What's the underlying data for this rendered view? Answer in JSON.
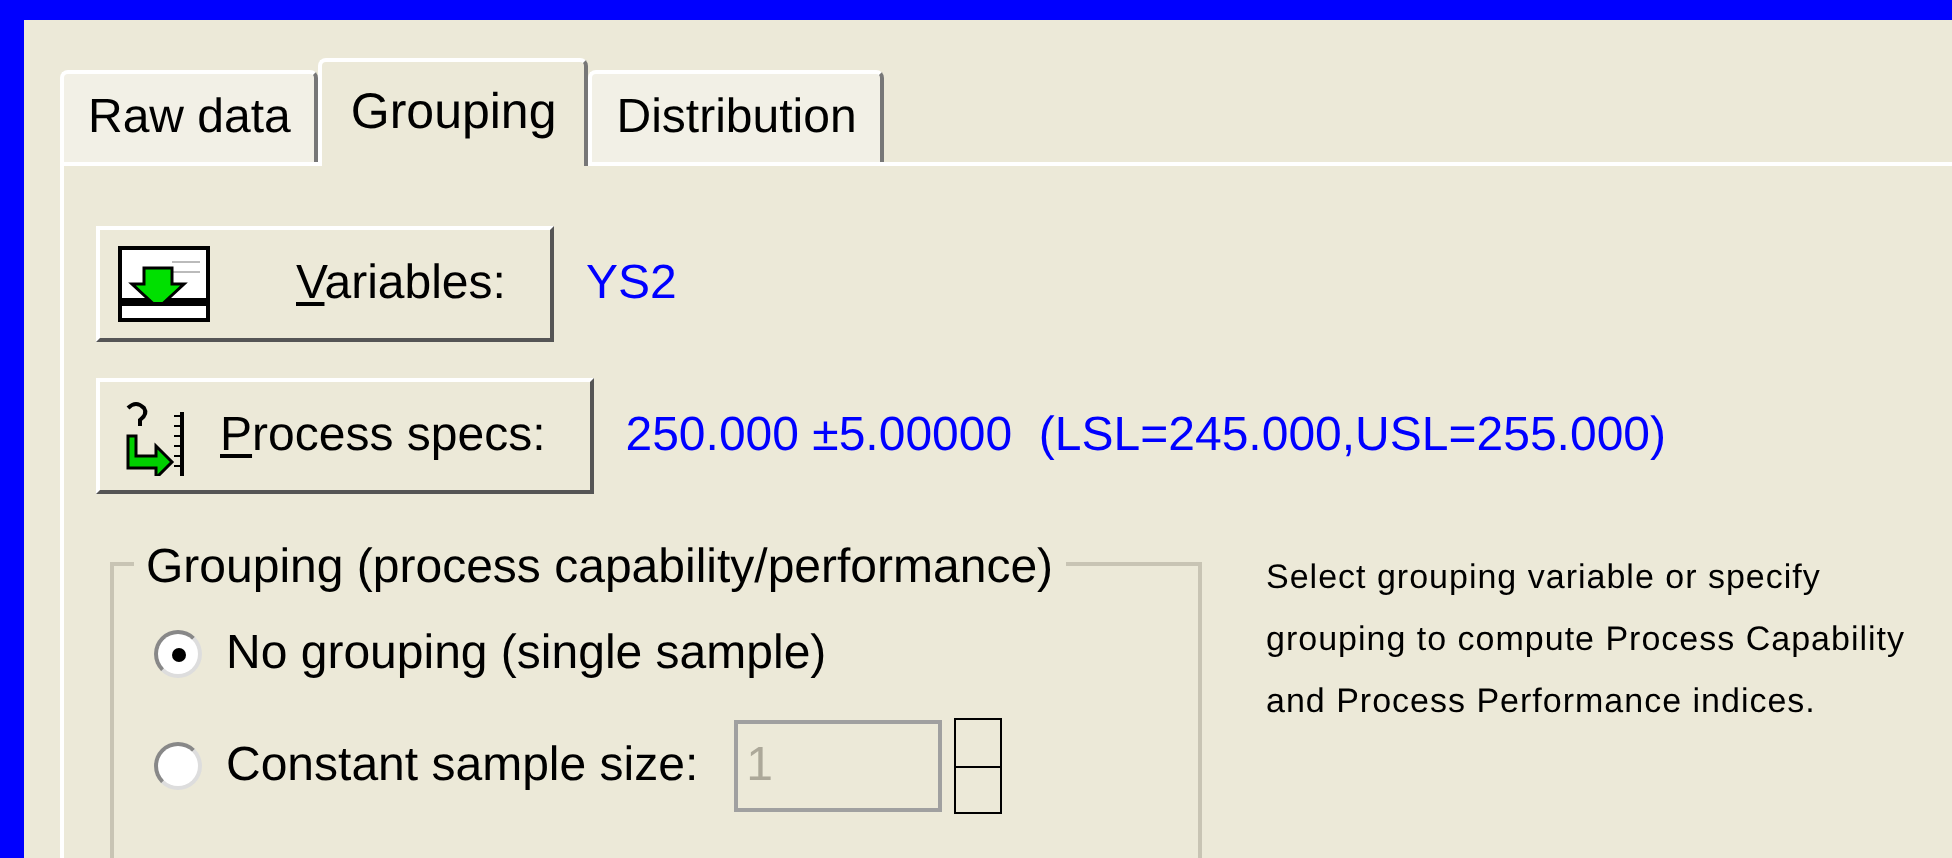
{
  "tabs": [
    {
      "label": "Raw data",
      "selected": false
    },
    {
      "label": "Grouping",
      "selected": true
    },
    {
      "label": "Distribution",
      "selected": false
    }
  ],
  "buttons": [
    {
      "kind": "variables",
      "label": "Variables:",
      "value": "YS2"
    },
    {
      "kind": "specs",
      "label": "Process specs:",
      "value": "250.000 ±5.00000  (LSL=245.000,USL=255.000)"
    }
  ],
  "grouping": {
    "title": "Grouping (process capability/performance)",
    "options": [
      {
        "label": "No grouping (single sample)",
        "selected": true
      },
      {
        "label": "Constant sample size:",
        "selected": false
      }
    ],
    "sample_size": {
      "value": "1",
      "disabled": true
    }
  },
  "help_text": "Select grouping variable or specify grouping to compute Process Capability and Process Performance indices."
}
